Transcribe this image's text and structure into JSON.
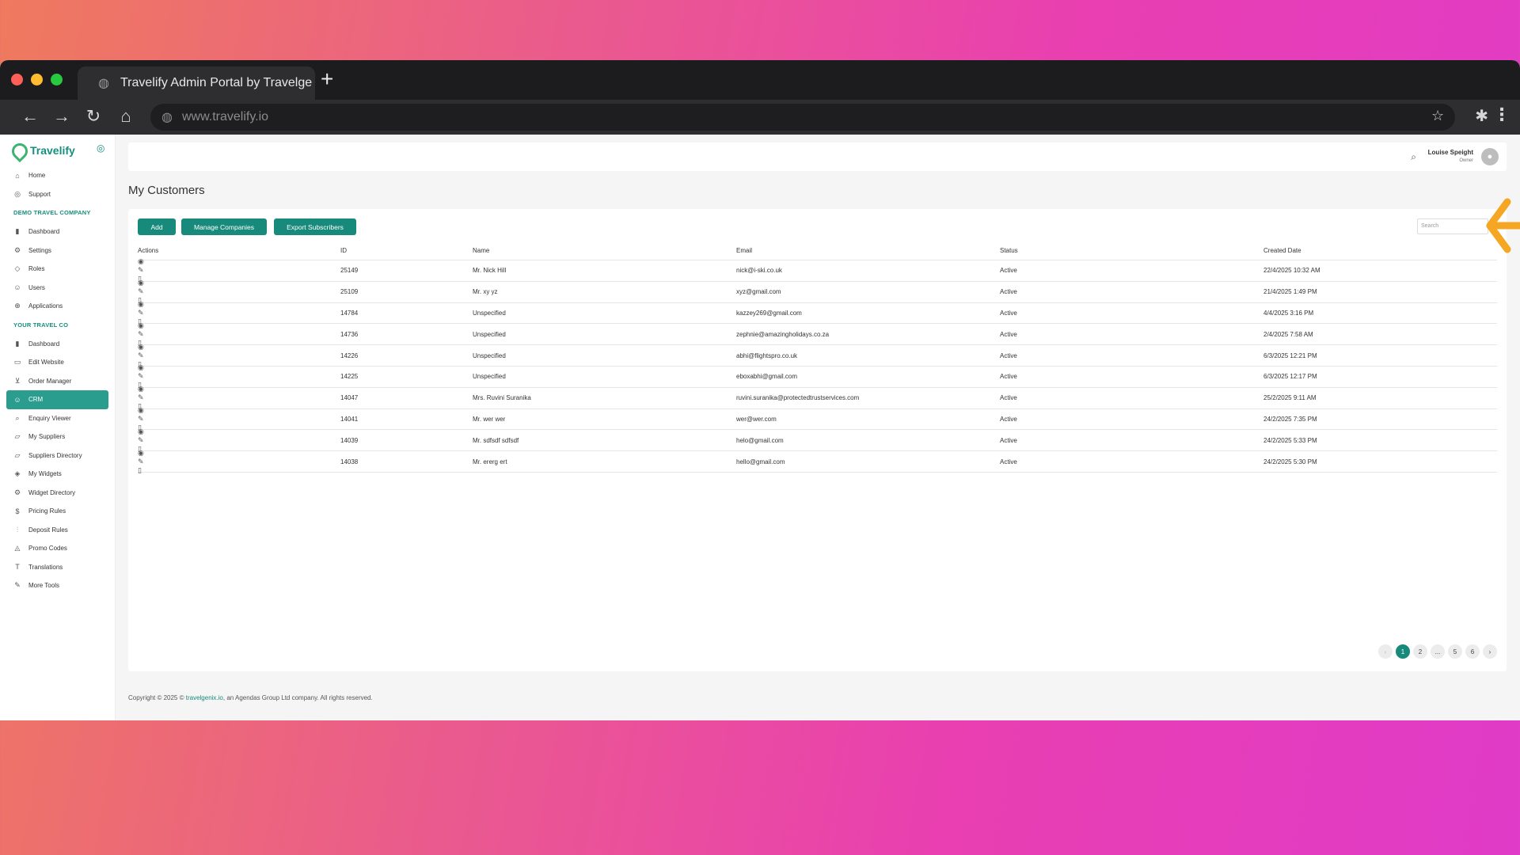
{
  "browser": {
    "tab_title": "Travelify Admin Portal by Travelge",
    "new_tab": "+",
    "url": "www.travelify.io"
  },
  "brand": {
    "name": "Travelify"
  },
  "sidebar": {
    "top_items": [
      {
        "label": "Home",
        "icon": "home-icon",
        "glyph": "⌂"
      },
      {
        "label": "Support",
        "icon": "support-icon",
        "glyph": "◎"
      }
    ],
    "section1": {
      "label": "DEMO TRAVEL COMPANY",
      "items": [
        {
          "label": "Dashboard",
          "icon": "chart-icon",
          "glyph": "▮"
        },
        {
          "label": "Settings",
          "icon": "gear-icon",
          "glyph": "⚙"
        },
        {
          "label": "Roles",
          "icon": "shield-icon",
          "glyph": "◇"
        },
        {
          "label": "Users",
          "icon": "users-icon",
          "glyph": "☺"
        },
        {
          "label": "Applications",
          "icon": "globe-icon",
          "glyph": "⊕"
        }
      ]
    },
    "section2": {
      "label": "YOUR TRAVEL CO",
      "items": [
        {
          "label": "Dashboard",
          "icon": "chart-icon",
          "glyph": "▮"
        },
        {
          "label": "Edit Website",
          "icon": "monitor-icon",
          "glyph": "▭"
        },
        {
          "label": "Order Manager",
          "icon": "cart-icon",
          "glyph": "⊻"
        },
        {
          "label": "CRM",
          "icon": "users-icon",
          "glyph": "☺",
          "active": true
        },
        {
          "label": "Enquiry Viewer",
          "icon": "search-icon",
          "glyph": "⌕"
        },
        {
          "label": "My Suppliers",
          "icon": "folder-icon",
          "glyph": "▱"
        },
        {
          "label": "Suppliers Directory",
          "icon": "folder-icon",
          "glyph": "▱"
        },
        {
          "label": "My Widgets",
          "icon": "cube-icon",
          "glyph": "◈"
        },
        {
          "label": "Widget Directory",
          "icon": "gear-icon",
          "glyph": "⚙"
        },
        {
          "label": "Pricing Rules",
          "icon": "dollar-icon",
          "glyph": "$"
        },
        {
          "label": "Deposit Rules",
          "icon": "sliders-icon",
          "glyph": "⫶"
        },
        {
          "label": "Promo Codes",
          "icon": "tag-icon",
          "glyph": "◬"
        },
        {
          "label": "Translations",
          "icon": "text-icon",
          "glyph": "T"
        },
        {
          "label": "More Tools",
          "icon": "wrench-icon",
          "glyph": "✎"
        }
      ]
    }
  },
  "header": {
    "user_name": "Louise Speight",
    "user_role": "Owner"
  },
  "page": {
    "title": "My Customers"
  },
  "toolbar": {
    "add_label": "Add",
    "manage_label": "Manage Companies",
    "export_label": "Export Subscribers",
    "search_placeholder": "Search"
  },
  "table": {
    "columns": [
      "Actions",
      "ID",
      "Name",
      "Email",
      "Status",
      "Created Date"
    ],
    "rows": [
      {
        "id": "25149",
        "name": "Mr. Nick Hill",
        "email": "nick@i-ski.co.uk",
        "status": "Active",
        "date": "22/4/2025 10:32 AM"
      },
      {
        "id": "25109",
        "name": "Mr. xy yz",
        "email": "xyz@gmail.com",
        "status": "Active",
        "date": "21/4/2025 1:49 PM"
      },
      {
        "id": "14784",
        "name": "Unspecified",
        "email": "kazzey269@gmail.com",
        "status": "Active",
        "date": "4/4/2025 3:16 PM"
      },
      {
        "id": "14736",
        "name": "Unspecified",
        "email": "zephnie@amazingholidays.co.za",
        "status": "Active",
        "date": "2/4/2025 7:58 AM"
      },
      {
        "id": "14226",
        "name": "Unspecified",
        "email": "abhi@flightspro.co.uk",
        "status": "Active",
        "date": "6/3/2025 12:21 PM"
      },
      {
        "id": "14225",
        "name": "Unspecified",
        "email": "eboxabhi@gmail.com",
        "status": "Active",
        "date": "6/3/2025 12:17 PM"
      },
      {
        "id": "14047",
        "name": "Mrs. Ruvini Suranika",
        "email": "ruvini.suranika@protectedtrustservices.com",
        "status": "Active",
        "date": "25/2/2025 9:11 AM"
      },
      {
        "id": "14041",
        "name": "Mr. wer wer",
        "email": "wer@wer.com",
        "status": "Active",
        "date": "24/2/2025 7:35 PM"
      },
      {
        "id": "14039",
        "name": "Mr. sdfsdf sdfsdf",
        "email": "helo@gmail.com",
        "status": "Active",
        "date": "24/2/2025 5:33 PM"
      },
      {
        "id": "14038",
        "name": "Mr. ererg ert",
        "email": "hello@gmail.com",
        "status": "Active",
        "date": "24/2/2025 5:30 PM"
      }
    ]
  },
  "pagination": {
    "prev": "‹",
    "pages": [
      "1",
      "2",
      "...",
      "5",
      "6"
    ],
    "current": "1",
    "next": "›"
  },
  "footer": {
    "prefix": "Copyright © 2025 ©",
    "link": "travelgenix.io",
    "suffix": ", an Agendas Group Ltd company. All rights reserved."
  },
  "colors": {
    "accent": "#178a7c",
    "annotation_arrow": "#f5a623"
  }
}
